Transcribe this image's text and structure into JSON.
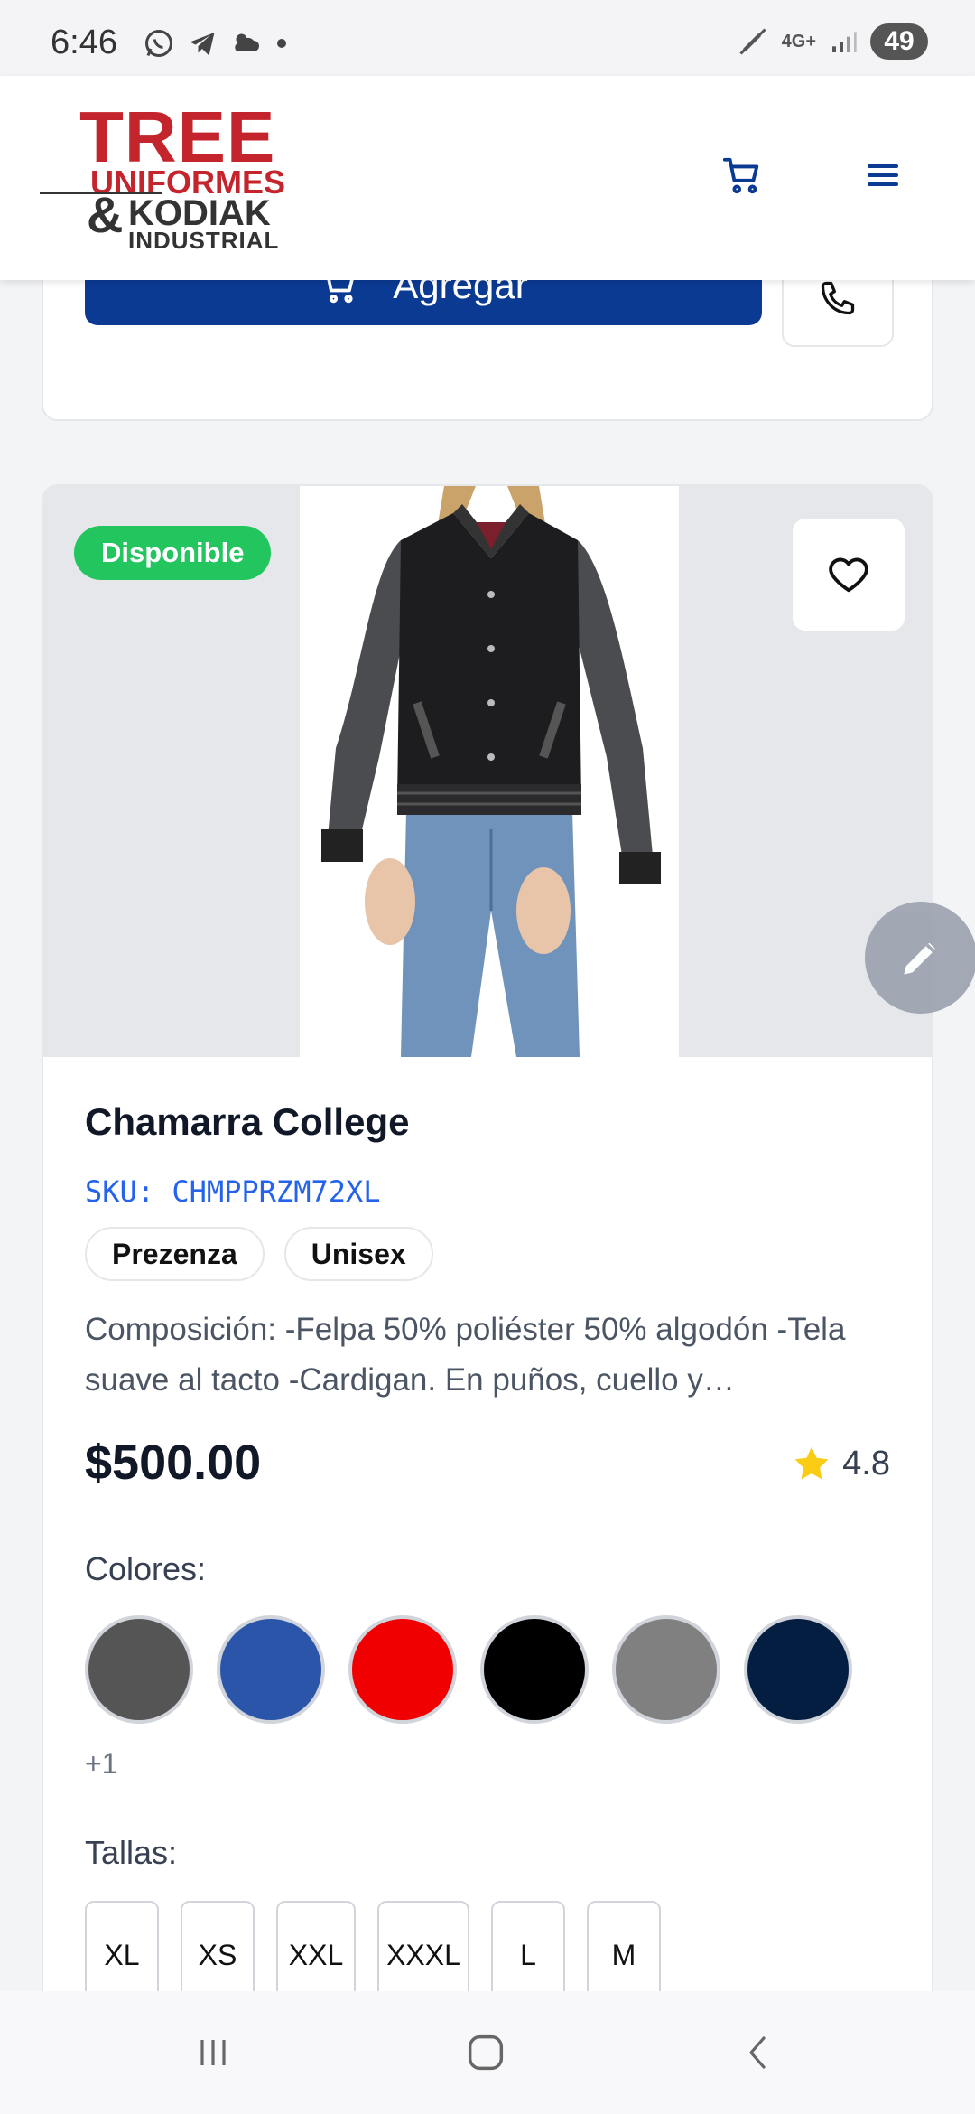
{
  "status_bar": {
    "time": "6:46",
    "network": "4G+",
    "battery": "49"
  },
  "header": {
    "logo": {
      "line1": "TREE",
      "line2": "UNIFORMES",
      "amp": "&",
      "line3": "KODIAK",
      "line4": "INDUSTRIAL"
    },
    "cart_icon": "cart-icon",
    "menu_icon": "hamburger-icon"
  },
  "previous_card": {
    "add_label": "Agregar"
  },
  "product": {
    "availability": "Disponible",
    "title": "Chamarra College",
    "sku": "SKU: CHMPPRZM72XL",
    "tags": [
      "Prezenza",
      "Unisex"
    ],
    "description": "Composición: -Felpa 50% poliéster 50% algodón -Tela suave al tacto -Cardigan. En puños, cuello y…",
    "price": "$500.00",
    "rating": "4.8",
    "colors_label": "Colores:",
    "colors": [
      "#555555",
      "#2a55a8",
      "#f00000",
      "#000000",
      "#808080",
      "#041e42"
    ],
    "more_colors": "+1",
    "sizes_label": "Tallas:",
    "sizes": [
      "XL",
      "XS",
      "XXL",
      "XXXL",
      "L",
      "M"
    ]
  },
  "colors": {
    "primary": "#0b3a93",
    "available": "#22c55e",
    "sku": "#2563eb",
    "star": "#facc15"
  }
}
